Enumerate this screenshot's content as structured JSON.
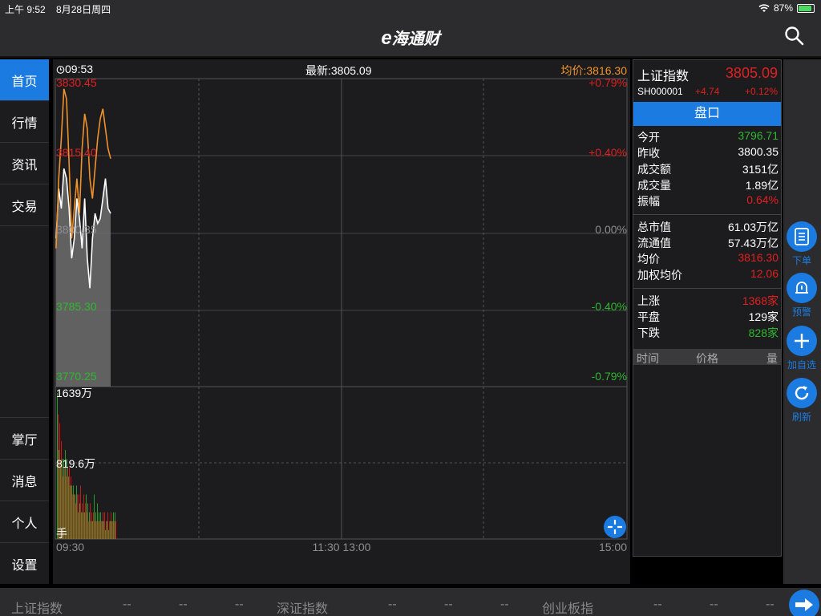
{
  "status": {
    "time": "上午 9:52",
    "date": "8月28日周四",
    "battery": "87%",
    "battery_level": 0.87
  },
  "nav": {
    "logo_e": "e",
    "logo_text": "海通财",
    "search_icon": "search-icon"
  },
  "sidebar": {
    "items": [
      {
        "label": "首页",
        "active": true
      },
      {
        "label": "行情"
      },
      {
        "label": "资讯"
      },
      {
        "label": "交易"
      }
    ],
    "bottom_items": [
      {
        "label": "掌厅"
      },
      {
        "label": "消息"
      },
      {
        "label": "个人"
      },
      {
        "label": "设置"
      }
    ]
  },
  "chart_header": {
    "time": "09:53",
    "latest": "最新:3805.09",
    "avg": "均价:3816.30"
  },
  "chart_data": {
    "type": "line",
    "price_axis_left": [
      "3830.45",
      "3815.40",
      "3800.35",
      "3785.30",
      "3770.25"
    ],
    "price_axis_right": [
      "+0.79%",
      "+0.40%",
      "0.00%",
      "-0.40%",
      "-0.79%"
    ],
    "volume_axis": [
      "1639万",
      "819.6万",
      "手"
    ],
    "time_axis": [
      "09:30",
      "11:30 13:00",
      "15:00"
    ],
    "ylim": [
      3770.25,
      3830.45
    ],
    "series": [
      {
        "values": [
          3798,
          3812,
          3820,
          3830,
          3828,
          3815,
          3800,
          3806,
          3812,
          3805,
          3818,
          3825,
          3822,
          3812,
          3808,
          3814,
          3820,
          3824,
          3826,
          3822,
          3818,
          3816
        ]
      },
      {
        "values": [
          3800,
          3810,
          3806,
          3814,
          3812,
          3806,
          3796,
          3800,
          3808,
          3804,
          3798,
          3808,
          3796,
          3790,
          3800,
          3805,
          3803,
          3804,
          3808,
          3812,
          3806,
          3805
        ]
      }
    ],
    "volume": [
      16.39,
      14,
      10,
      13,
      8,
      11,
      9,
      7,
      9,
      8,
      10,
      7,
      9,
      8,
      7,
      8,
      6,
      7,
      6,
      5,
      6,
      5,
      5,
      4,
      6,
      5,
      3,
      5,
      4,
      6,
      3,
      4,
      3,
      5,
      3,
      4,
      5,
      3,
      4,
      2,
      3,
      4,
      2,
      3,
      2,
      3,
      5,
      2,
      3,
      2,
      4,
      2,
      3,
      2,
      3,
      2,
      2,
      3,
      2,
      3,
      1,
      2,
      2,
      3,
      1,
      2,
      2,
      3,
      2,
      2,
      3,
      2,
      3,
      2
    ],
    "volume_max": 16.39,
    "colors": {
      "avg": "#f0922b",
      "price": "#ffffff",
      "up": "#e02020",
      "down": "#2fb82f"
    }
  },
  "quote": {
    "name": "上证指数",
    "price": "3805.09",
    "code": "SH000001",
    "change": "+4.74",
    "pct": "+0.12%",
    "tab": "盘口",
    "rows1": [
      {
        "label": "今开",
        "value": "3796.71",
        "color": "#2fb82f"
      },
      {
        "label": "昨收",
        "value": "3800.35",
        "color": "#ffffff"
      },
      {
        "label": "成交额",
        "value": "3151亿",
        "color": "#ffffff"
      },
      {
        "label": "成交量",
        "value": "1.89亿",
        "color": "#ffffff"
      },
      {
        "label": "振幅",
        "value": "0.64%",
        "color": "#e02020"
      }
    ],
    "rows2": [
      {
        "label": "总市值",
        "value": "61.03万亿",
        "color": "#ffffff"
      },
      {
        "label": "流通值",
        "value": "57.43万亿",
        "color": "#ffffff"
      },
      {
        "label": "均价",
        "value": "3816.30",
        "color": "#e02020"
      },
      {
        "label": "加权均价",
        "value": "12.06",
        "color": "#e02020"
      }
    ],
    "rows3": [
      {
        "label": "上涨",
        "value": "1368家",
        "color": "#e02020"
      },
      {
        "label": "平盘",
        "value": "129家",
        "color": "#ffffff"
      },
      {
        "label": "下跌",
        "value": "828家",
        "color": "#2fb82f"
      }
    ],
    "table_head": {
      "time": "时间",
      "price": "价格",
      "qty": "量"
    }
  },
  "rail": {
    "order": "下单",
    "alert": "预警",
    "add": "加自选",
    "refresh": "刷新"
  },
  "ticker": {
    "sh": "上证指数",
    "sh_a": "--",
    "sh_b": "--",
    "sh_c": "--",
    "sz": "深证指数",
    "sz_a": "--",
    "sz_b": "--",
    "sz_c": "--",
    "cy": "创业板指",
    "cy_a": "--",
    "cy_b": "--",
    "cy_c": "--"
  }
}
